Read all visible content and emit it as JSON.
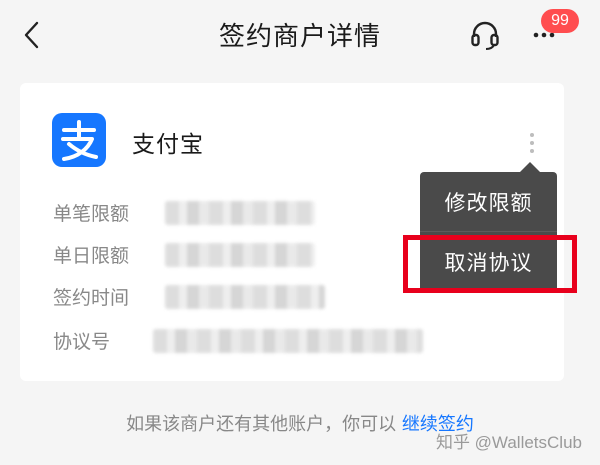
{
  "header": {
    "title": "签约商户详情",
    "badge_count": "99",
    "back_icon": "chevron-left-icon",
    "support_icon": "headset-icon",
    "more_icon": "more-dots-icon"
  },
  "merchant": {
    "name": "支付宝",
    "logo_icon": "alipay-logo-icon",
    "logo_color": "#1677ff"
  },
  "details": {
    "rows": [
      {
        "label": "单笔限额"
      },
      {
        "label": "单日限额"
      },
      {
        "label": "签约时间"
      },
      {
        "label": "协议号"
      }
    ]
  },
  "popup_menu": {
    "items": [
      {
        "label": "修改限额"
      },
      {
        "label": "取消协议"
      }
    ],
    "highlight_color": "#e8001c"
  },
  "footer": {
    "text": "如果该商户还有其他账户，你可以",
    "link": "继续签约"
  },
  "watermark": "知乎 @WalletsClub"
}
